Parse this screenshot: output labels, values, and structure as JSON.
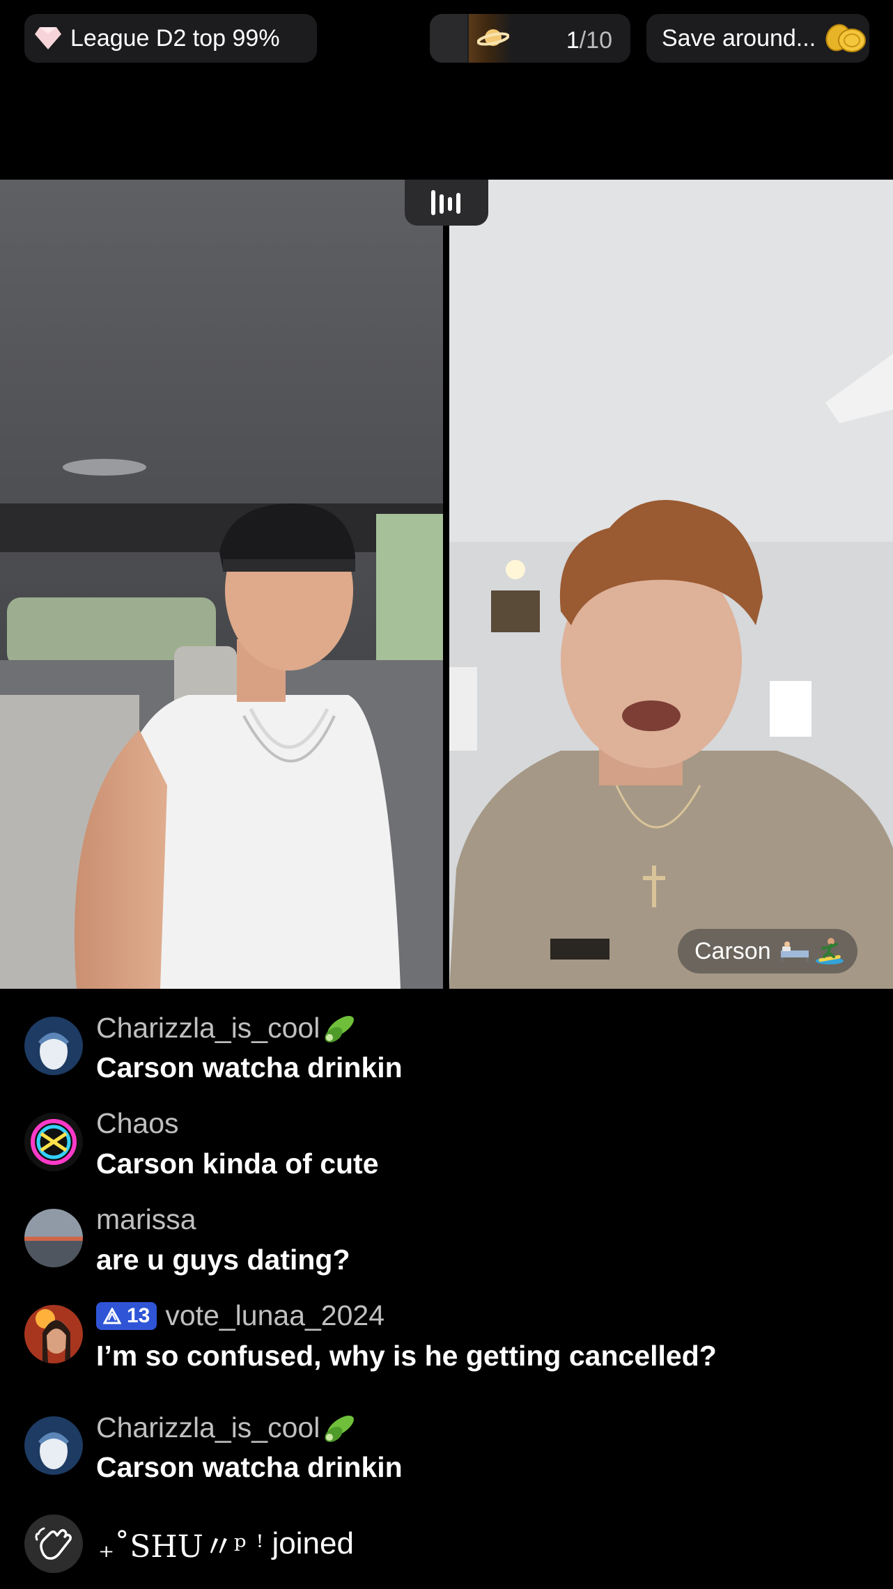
{
  "top_bar": {
    "league_label": "League D2 top 99%",
    "league_icon": "diamond-icon",
    "rank_current": "1",
    "rank_total": "/10",
    "rank_icon": "planet-icon",
    "save_label": "Save around...",
    "save_icon": "coins-icon"
  },
  "video": {
    "mute_icon": "audio-bars-icon",
    "right_name": "Carson",
    "right_name_emoji": [
      "bed-icon",
      "surfer-icon"
    ]
  },
  "comments": [
    {
      "user": "Charizzla_is_cool",
      "user_emoji": "cucumber-icon",
      "text": "Carson watcha drinkin"
    },
    {
      "user": "Chaos",
      "text": "Carson kinda of cute"
    },
    {
      "user": "marissa",
      "text": "are u guys dating?"
    },
    {
      "user": "vote_lunaa_2024",
      "badge_level": "13",
      "text": "I’m so confused, why is he getting cancelled?"
    },
    {
      "user": "Charizzla_is_cool",
      "user_emoji": "cucumber-icon",
      "text": "Carson watcha drinkin"
    }
  ],
  "join_event": {
    "user": "₊˚SHU〃ᵖ ꜝ",
    "verb": "joined",
    "icon": "waving-hand-icon"
  },
  "colors": {
    "background": "#000000",
    "pill": "#1c1c1e",
    "username": "#c0c0c0",
    "badge": "#2f55d6"
  }
}
